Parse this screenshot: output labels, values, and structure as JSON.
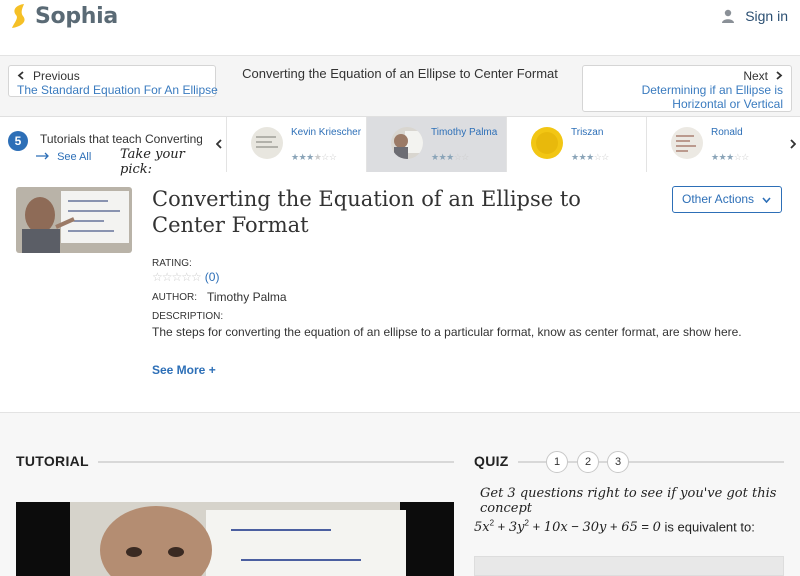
{
  "brand": {
    "name": "Sophia",
    "color": "#f5c026"
  },
  "header": {
    "signin_label": "Sign in"
  },
  "nav": {
    "previous_label": "Previous",
    "previous_link": "The Standard Equation For An Ellipse",
    "current_title": "Converting the Equation of an Ellipse to Center Format",
    "next_label": "Next",
    "next_link": "Determining if an Ellipse is Horizontal or Vertical"
  },
  "tutorials_strip": {
    "count": "5",
    "title": "Tutorials that teach Converting the Equation of an Ellipse to Center Format",
    "see_all": "See All",
    "take_pick": "Take your pick:",
    "tutors": [
      {
        "name": "Kevin Kriescher",
        "stars_filled": 3.5,
        "active": false
      },
      {
        "name": "Timothy Palma",
        "stars_filled": 3,
        "active": true
      },
      {
        "name": "Triszan",
        "stars_filled": 3,
        "active": false
      },
      {
        "name": "Ronald",
        "stars_filled": 3,
        "active": false
      }
    ]
  },
  "tutorial": {
    "title": "Converting the Equation of an Ellipse to Center Format",
    "other_actions": "Other Actions",
    "rating_label": "RATING:",
    "rating_count": "(0)",
    "author_label": "AUTHOR:",
    "author": "Timothy Palma",
    "description_label": "DESCRIPTION:",
    "description": "The steps for converting the equation of an ellipse to a particular format, know as center format, are show here.",
    "see_more": "See More +"
  },
  "sections": {
    "tutorial_heading": "TUTORIAL",
    "quiz_heading": "QUIZ",
    "quiz_numbers": [
      "1",
      "2",
      "3"
    ],
    "quiz_tagline": "Get 3 questions right to see if you've got this concept",
    "quiz_question_suffix": "is equivalent to:"
  },
  "colors": {
    "link": "#2d6fb7",
    "accent_blue": "#3a7bbf"
  }
}
